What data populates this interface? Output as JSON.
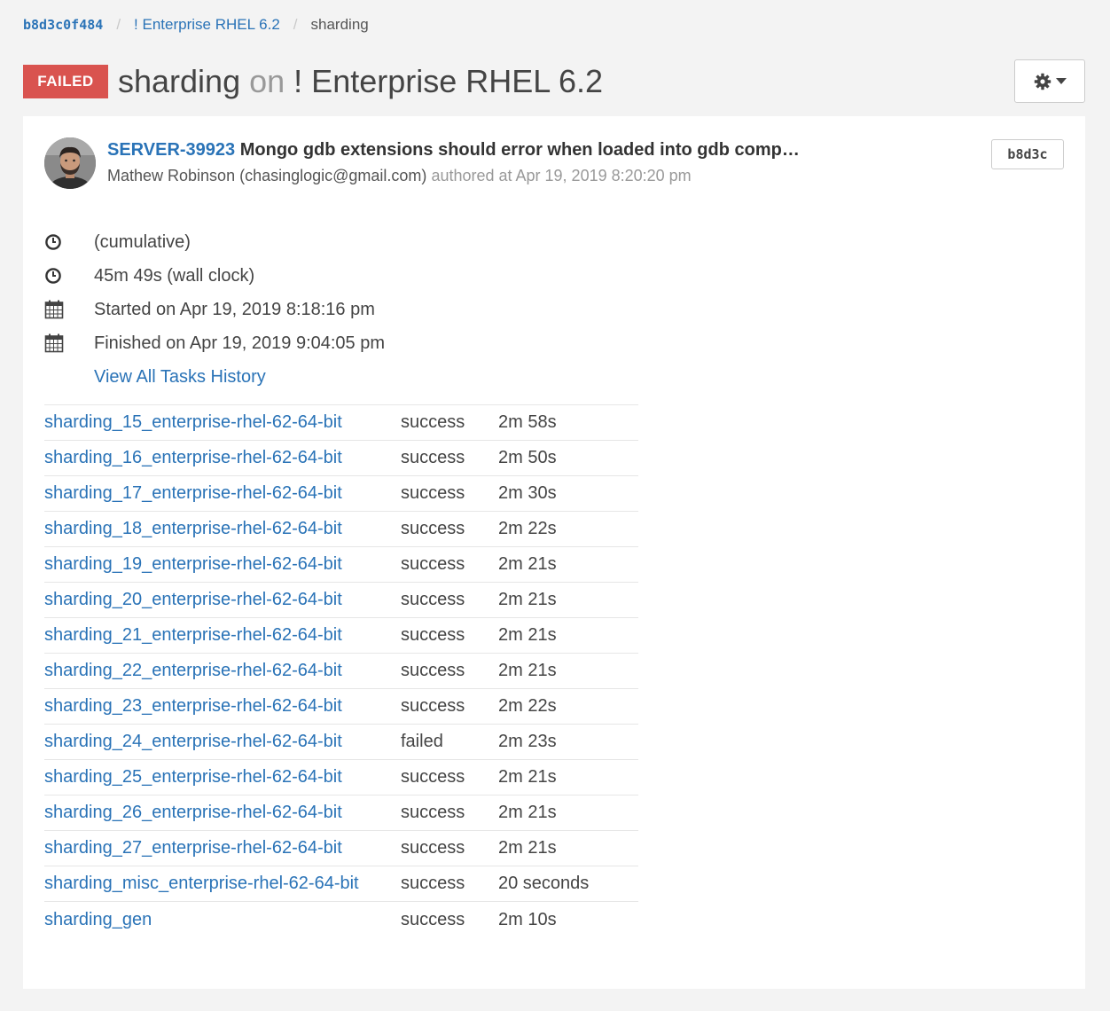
{
  "breadcrumb": {
    "hash": "b8d3c0f484",
    "variant": "! Enterprise RHEL 6.2",
    "task": "sharding"
  },
  "header": {
    "status_badge": "FAILED",
    "task_name": "sharding",
    "on_word": "on",
    "variant": "! Enterprise RHEL 6.2",
    "status_color": "#d9534f"
  },
  "commit": {
    "ticket": "SERVER-39923",
    "message": "Mongo gdb extensions should error when loaded into gdb comp…",
    "author": "Mathew Robinson (chasinglogic@gmail.com)",
    "authored_text": "authored at Apr 19, 2019 8:20:20 pm",
    "short_hash": "b8d3c"
  },
  "meta": {
    "cumulative": "(cumulative)",
    "wall_clock": "45m 49s (wall clock)",
    "started": "Started on Apr 19, 2019 8:18:16 pm",
    "finished": "Finished on Apr 19, 2019 9:04:05 pm",
    "history_link": "View All Tasks History"
  },
  "tasks": [
    {
      "name": "sharding_15_enterprise-rhel-62-64-bit",
      "status": "success",
      "time": "2m 58s"
    },
    {
      "name": "sharding_16_enterprise-rhel-62-64-bit",
      "status": "success",
      "time": "2m 50s"
    },
    {
      "name": "sharding_17_enterprise-rhel-62-64-bit",
      "status": "success",
      "time": "2m 30s"
    },
    {
      "name": "sharding_18_enterprise-rhel-62-64-bit",
      "status": "success",
      "time": "2m 22s"
    },
    {
      "name": "sharding_19_enterprise-rhel-62-64-bit",
      "status": "success",
      "time": "2m 21s"
    },
    {
      "name": "sharding_20_enterprise-rhel-62-64-bit",
      "status": "success",
      "time": "2m 21s"
    },
    {
      "name": "sharding_21_enterprise-rhel-62-64-bit",
      "status": "success",
      "time": "2m 21s"
    },
    {
      "name": "sharding_22_enterprise-rhel-62-64-bit",
      "status": "success",
      "time": "2m 21s"
    },
    {
      "name": "sharding_23_enterprise-rhel-62-64-bit",
      "status": "success",
      "time": "2m 22s"
    },
    {
      "name": "sharding_24_enterprise-rhel-62-64-bit",
      "status": "failed",
      "time": "2m 23s"
    },
    {
      "name": "sharding_25_enterprise-rhel-62-64-bit",
      "status": "success",
      "time": "2m 21s"
    },
    {
      "name": "sharding_26_enterprise-rhel-62-64-bit",
      "status": "success",
      "time": "2m 21s"
    },
    {
      "name": "sharding_27_enterprise-rhel-62-64-bit",
      "status": "success",
      "time": "2m 21s"
    },
    {
      "name": "sharding_misc_enterprise-rhel-62-64-bit",
      "status": "success",
      "time": "20 seconds"
    },
    {
      "name": "sharding_gen",
      "status": "success",
      "time": "2m 10s"
    }
  ],
  "icons": {
    "settings": "gear-icon",
    "dropdown": "caret-down-icon",
    "duration": "clock-icon",
    "date": "calendar-icon"
  },
  "colors": {
    "link": "#2a73b7",
    "failed": "#d9534f"
  }
}
